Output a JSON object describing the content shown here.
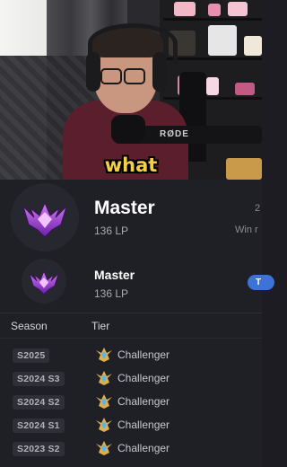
{
  "video": {
    "caption": "what",
    "mic_brand": "RØDE"
  },
  "profile": {
    "current": {
      "tier": "Master",
      "lp": "136 LP",
      "right_top": "2",
      "right_bottom": "Win r"
    },
    "secondary": {
      "tier": "Master",
      "lp": "136 LP",
      "badge": "T"
    }
  },
  "history": {
    "headers": {
      "season": "Season",
      "tier": "Tier"
    },
    "rows": [
      {
        "season": "S2025",
        "tier": "Challenger"
      },
      {
        "season": "S2024 S3",
        "tier": "Challenger"
      },
      {
        "season": "S2024 S2",
        "tier": "Challenger"
      },
      {
        "season": "S2024 S1",
        "tier": "Challenger"
      },
      {
        "season": "S2023 S2",
        "tier": "Challenger"
      }
    ]
  },
  "colors": {
    "background": "#1f1f26",
    "caption": "#f4d048",
    "master_purple": "#9b3fd0",
    "challenger_gold": "#e2b04a",
    "challenger_blue": "#5fb4e6",
    "badge_blue": "#3b73d9"
  },
  "icons": {
    "master_emblem": "master-emblem-icon",
    "challenger_emblem": "challenger-emblem-icon"
  }
}
